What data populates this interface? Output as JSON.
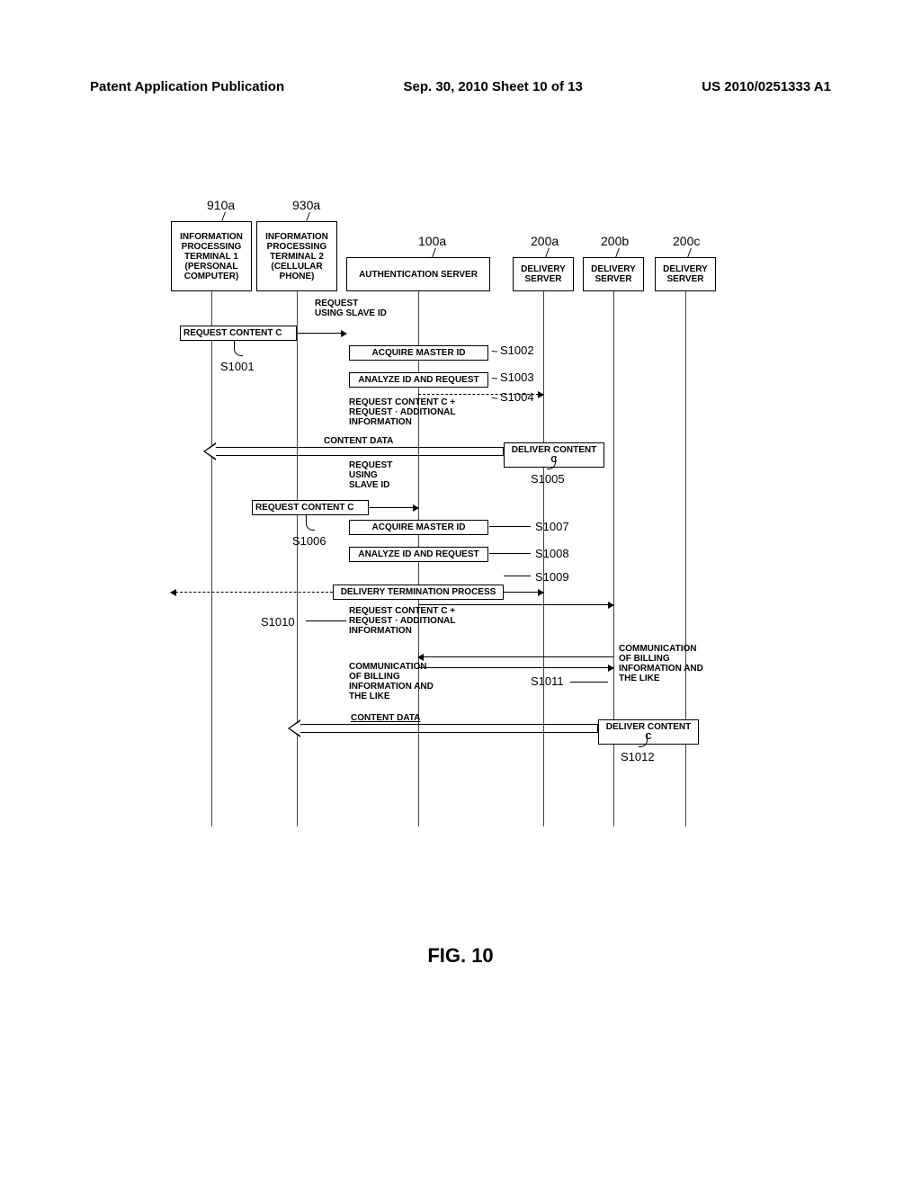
{
  "header": {
    "left": "Patent Application Publication",
    "center": "Sep. 30, 2010  Sheet 10 of 13",
    "right": "US 2010/0251333 A1"
  },
  "lanes": {
    "t1": {
      "ref": "910a",
      "label": "INFORMATION PROCESSING TERMINAL 1 (PERSONAL COMPUTER)"
    },
    "t2": {
      "ref": "930a",
      "label": "INFORMATION PROCESSING TERMINAL 2 (CELLULAR PHONE)"
    },
    "auth": {
      "ref": "100a",
      "label": "AUTHENTICATION SERVER"
    },
    "ds1": {
      "ref": "200a",
      "label": "DELIVERY SERVER"
    },
    "ds2": {
      "ref": "200b",
      "label": "DELIVERY SERVER"
    },
    "ds3": {
      "ref": "200c",
      "label": "DELIVERY SERVER"
    }
  },
  "msgs": {
    "req_slave1": "REQUEST USING SLAVE ID",
    "req_content_c": "REQUEST CONTENT C",
    "acquire_master": "ACQUIRE MASTER ID",
    "analyze": "ANALYZE ID AND REQUEST",
    "req_plus": "REQUEST CONTENT C + REQUEST · ADDITIONAL INFORMATION",
    "content_data": "CONTENT DATA",
    "deliver_c": "DELIVER CONTENT C",
    "req_slave2": "REQUEST USING SLAVE ID",
    "delivery_term": "DELIVERY TERMINATION PROCESS",
    "comm_billing": "COMMUNICATION OF BILLING INFORMATION AND THE LIKE"
  },
  "steps": {
    "s1001": "S1001",
    "s1002": "S1002",
    "s1003": "S1003",
    "s1004": "S1004",
    "s1005": "S1005",
    "s1006": "S1006",
    "s1007": "S1007",
    "s1008": "S1008",
    "s1009": "S1009",
    "s1010": "S1010",
    "s1011": "S1011",
    "s1012": "S1012"
  },
  "caption": "FIG. 10",
  "chart_data": {
    "type": "sequence-diagram",
    "participants": [
      {
        "id": "910a",
        "name": "INFORMATION PROCESSING TERMINAL 1 (PERSONAL COMPUTER)"
      },
      {
        "id": "930a",
        "name": "INFORMATION PROCESSING TERMINAL 2 (CELLULAR PHONE)"
      },
      {
        "id": "100a",
        "name": "AUTHENTICATION SERVER"
      },
      {
        "id": "200a",
        "name": "DELIVERY SERVER"
      },
      {
        "id": "200b",
        "name": "DELIVERY SERVER"
      },
      {
        "id": "200c",
        "name": "DELIVERY SERVER"
      }
    ],
    "messages": [
      {
        "step": "S1001",
        "from": "910a",
        "to": "100a",
        "label": "REQUEST CONTENT C",
        "note": "REQUEST USING SLAVE ID"
      },
      {
        "step": "S1002",
        "at": "100a",
        "label": "ACQUIRE MASTER ID"
      },
      {
        "step": "S1003",
        "at": "100a",
        "label": "ANALYZE ID AND REQUEST"
      },
      {
        "step": "S1004",
        "from": "100a",
        "to": "200a",
        "label": "REQUEST CONTENT C + REQUEST · ADDITIONAL INFORMATION"
      },
      {
        "step": "S1005",
        "from": "200a",
        "to": "910a",
        "label": "CONTENT DATA",
        "note": "DELIVER CONTENT C",
        "style": "block-arrow"
      },
      {
        "step": "S1006",
        "from": "930a",
        "to": "100a",
        "label": "REQUEST CONTENT C",
        "note": "REQUEST USING SLAVE ID"
      },
      {
        "step": "S1007",
        "at": "100a",
        "label": "ACQUIRE MASTER ID"
      },
      {
        "step": "S1008",
        "at": "100a",
        "label": "ANALYZE ID AND REQUEST"
      },
      {
        "step": "S1009",
        "from": "100a",
        "to": "200a",
        "label": "DELIVERY TERMINATION PROCESS",
        "target_also": "910a"
      },
      {
        "step": "S1010",
        "from": "100a",
        "to": "200b",
        "label": "REQUEST CONTENT C + REQUEST · ADDITIONAL INFORMATION"
      },
      {
        "step": "S1011",
        "between": [
          "100a",
          "200b"
        ],
        "label": "COMMUNICATION OF BILLING INFORMATION AND THE LIKE",
        "bidirectional": true
      },
      {
        "step": "S1012",
        "from": "200b",
        "to": "930a",
        "label": "CONTENT DATA",
        "note": "DELIVER CONTENT C",
        "style": "block-arrow"
      }
    ]
  }
}
